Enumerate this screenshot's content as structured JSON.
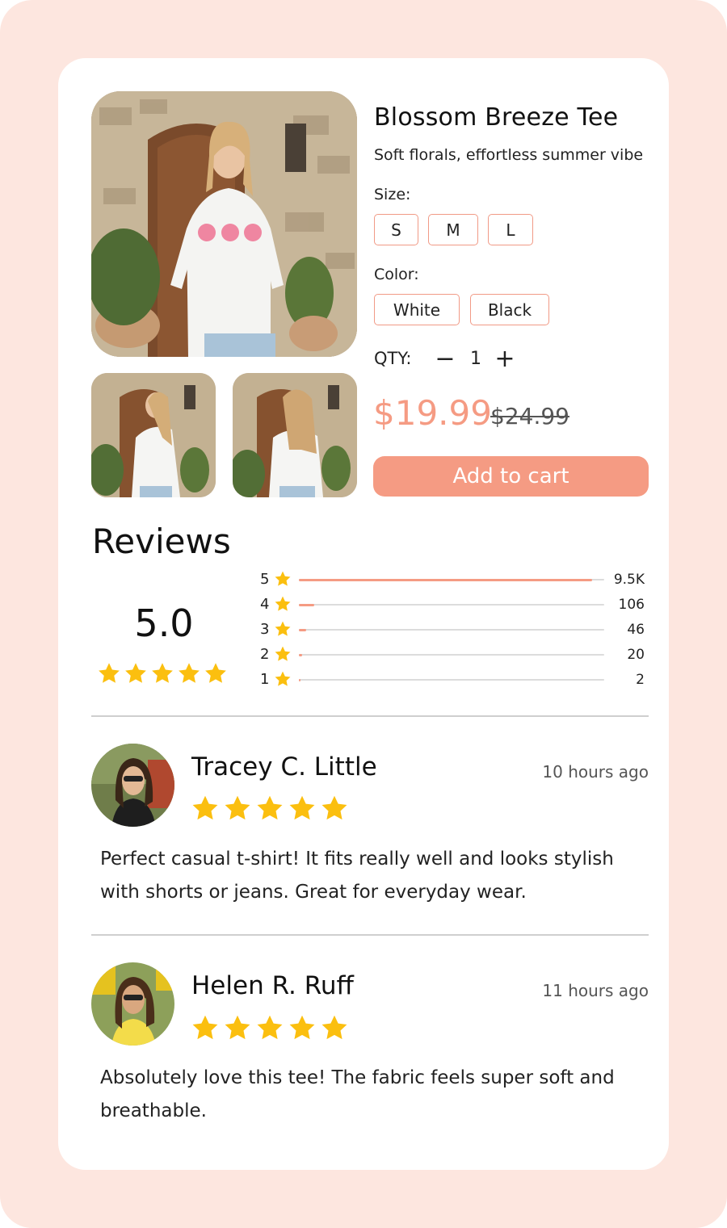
{
  "product": {
    "title": "Blossom Breeze Tee",
    "subtitle": "Soft florals, effortless summer vibe",
    "size_label": "Size:",
    "sizes": [
      "S",
      "M",
      "L"
    ],
    "color_label": "Color:",
    "colors": [
      "White",
      "Black"
    ],
    "qty_label": "QTY:",
    "qty_minus": "−",
    "qty_value": "1",
    "qty_plus": "+",
    "price": "$19.99",
    "old_price": "$24.99",
    "add_to_cart": "Add to cart"
  },
  "reviews": {
    "title": "Reviews",
    "average": "5.0",
    "average_stars": 5,
    "distribution": [
      {
        "stars": "5",
        "count": "9.5K",
        "fraction": 0.96
      },
      {
        "stars": "4",
        "count": "106",
        "fraction": 0.05
      },
      {
        "stars": "3",
        "count": "46",
        "fraction": 0.025
      },
      {
        "stars": "2",
        "count": "20",
        "fraction": 0.01
      },
      {
        "stars": "1",
        "count": "2",
        "fraction": 0.005
      }
    ],
    "items": [
      {
        "name": "Tracey C. Little",
        "time": "10 hours ago",
        "rating": 5,
        "text_line1": "Perfect casual t-shirt! It fits really well and looks stylish",
        "text_line2": "with shorts or jeans. Great for everyday wear."
      },
      {
        "name": "Helen R. Ruff",
        "time": "11 hours ago",
        "rating": 5,
        "text_line1": "Absolutely love this tee! The fabric feels super soft and",
        "text_line2": "breathable."
      }
    ]
  },
  "colors": {
    "accent": "#f59b83",
    "star": "#fbbf0f",
    "background": "#fde6df"
  }
}
